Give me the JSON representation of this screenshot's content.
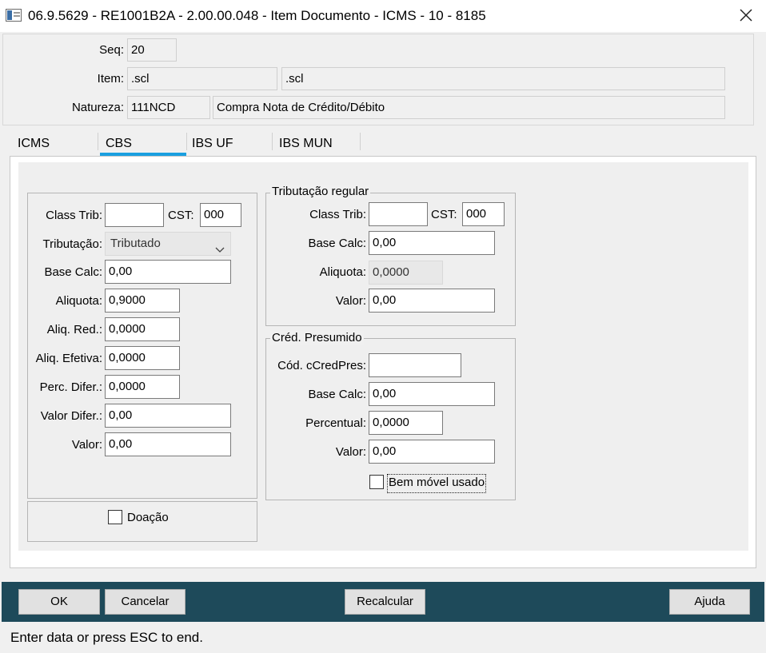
{
  "window": {
    "title": "06.9.5629 - RE1001B2A - 2.00.00.048 - Item Documento - ICMS - 10 - 8185"
  },
  "header": {
    "seq_label": "Seq:",
    "seq_value": "20",
    "item_label": "Item:",
    "item_value": ".scl",
    "item_desc": ".scl",
    "natureza_label": "Natureza:",
    "natureza_value": "111NCD",
    "natureza_desc": "Compra Nota de Crédito/Débito"
  },
  "tabs": [
    {
      "label": "ICMS"
    },
    {
      "label": "CBS"
    },
    {
      "label": "IBS UF"
    },
    {
      "label": "IBS MUN"
    }
  ],
  "active_tab": "CBS",
  "left": {
    "class_trib_label": "Class Trib:",
    "class_trib_value": "",
    "cst_label": "CST:",
    "cst_value": "000",
    "tributacao_label": "Tributação:",
    "tributacao_value": "Tributado",
    "base_calc_label": "Base Calc:",
    "base_calc_value": "0,00",
    "aliquota_label": "Aliquota:",
    "aliquota_value": "0,9000",
    "aliq_red_label": "Aliq. Red.:",
    "aliq_red_value": "0,0000",
    "aliq_efetiva_label": "Aliq. Efetiva:",
    "aliq_efetiva_value": "0,0000",
    "perc_difer_label": "Perc. Difer.:",
    "perc_difer_value": "0,0000",
    "valor_difer_label": "Valor Difer.:",
    "valor_difer_value": "0,00",
    "valor_label": "Valor:",
    "valor_value": "0,00",
    "doacao_label": "Doação",
    "doacao_checked": false
  },
  "trib_regular": {
    "title": "Tributação regular",
    "class_trib_label": "Class Trib:",
    "class_trib_value": "",
    "cst_label": "CST:",
    "cst_value": "000",
    "base_calc_label": "Base Calc:",
    "base_calc_value": "0,00",
    "aliquota_label": "Aliquota:",
    "aliquota_value": "0,0000",
    "valor_label": "Valor:",
    "valor_value": "0,00"
  },
  "cred_presumido": {
    "title": "Créd. Presumido",
    "cod_label": "Cód. cCredPres:",
    "cod_value": "",
    "base_calc_label": "Base Calc:",
    "base_calc_value": "0,00",
    "percentual_label": "Percentual:",
    "percentual_value": "0,0000",
    "valor_label": "Valor:",
    "valor_value": "0,00",
    "bem_movel_label": "Bem móvel usado",
    "bem_movel_checked": false
  },
  "buttons": {
    "ok": "OK",
    "cancelar": "Cancelar",
    "recalcular": "Recalcular",
    "ajuda": "Ajuda"
  },
  "status_bar": "Enter data or press ESC to end.",
  "colors": {
    "button_bar": "#1e4a5a",
    "tab_underline": "#1a9fe0"
  }
}
